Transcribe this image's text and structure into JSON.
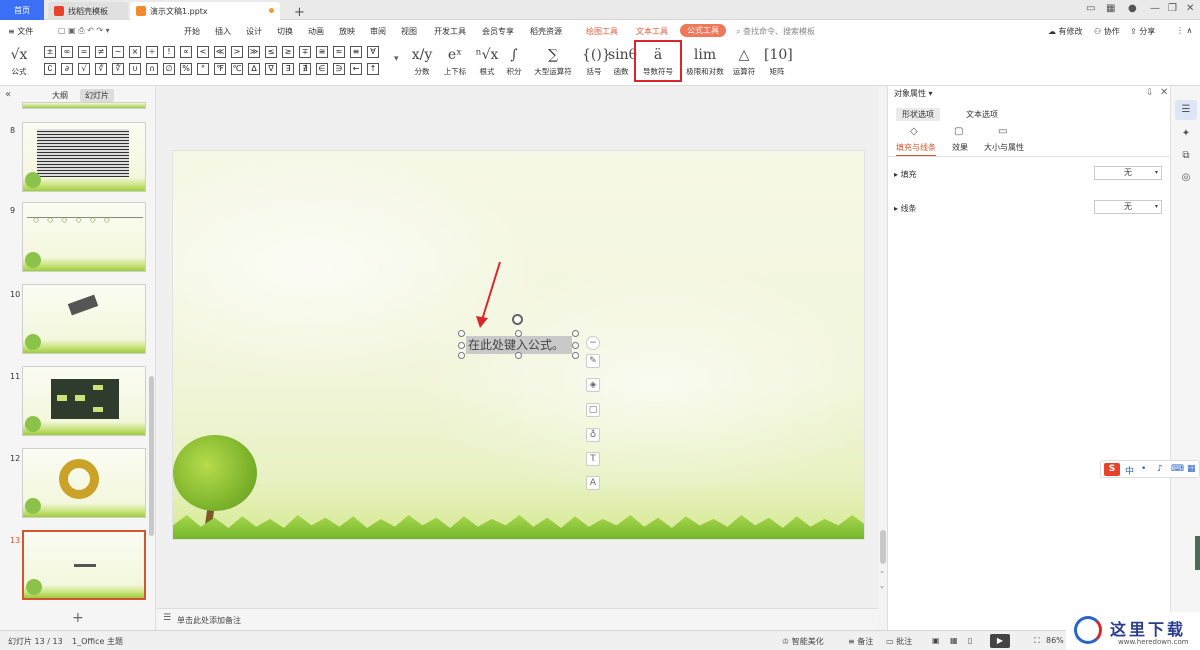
{
  "titlebar": {
    "home_tab": "首页",
    "template_tab": "找稻壳模板",
    "doc_tab": "演示文稿1.pptx",
    "add_tab": "+"
  },
  "menu": {
    "file": "≡ 文件",
    "items": [
      "开始",
      "插入",
      "设计",
      "切换",
      "动画",
      "放映",
      "审阅",
      "视图",
      "开发工具",
      "会员专享",
      "稻壳资源"
    ],
    "ctx_draw": "绘图工具",
    "ctx_text": "文本工具",
    "ctx_formula": "公式工具",
    "search": "查找命令、搜索模板",
    "changes": "有修改",
    "collab": "协作",
    "share": "分享"
  },
  "ribbon": {
    "formula_btn": "公式",
    "symbols_row1": [
      "±",
      "∞",
      "=",
      "≠",
      "~",
      "×",
      "÷",
      "!",
      "∝",
      "<",
      "≪",
      ">",
      "≫",
      "≤",
      "≥",
      "∓",
      "≅",
      "≈",
      "≡",
      "∀"
    ],
    "symbols_row2": [
      "∁",
      "∂",
      "√",
      "∛",
      "∜",
      "∪",
      "∩",
      "∅",
      "%",
      "°",
      "℉",
      "℃",
      "∆",
      "∇",
      "∃",
      "∄",
      "∈",
      "∋",
      "←",
      "↑"
    ],
    "groups": [
      {
        "icon": "x/y",
        "label": "分数"
      },
      {
        "icon": "eˣ",
        "label": "上下标"
      },
      {
        "icon": "ⁿ√x",
        "label": "根式"
      },
      {
        "icon": "∫",
        "label": "积分"
      },
      {
        "icon": "∑",
        "label": "大型运算符"
      },
      {
        "icon": "{()}",
        "label": "括号"
      },
      {
        "icon": "sinθ",
        "label": "函数"
      },
      {
        "icon": "ä",
        "label": "导数符号"
      },
      {
        "icon": "lim",
        "label": "极限和对数"
      },
      {
        "icon": "△",
        "label": "运算符"
      },
      {
        "icon": "[10]",
        "label": "矩阵"
      }
    ]
  },
  "left_panel": {
    "tab_outline": "大纲",
    "tab_slides": "幻灯片",
    "slides": [
      "8",
      "9",
      "10",
      "11",
      "12",
      "13"
    ],
    "active_slide": "13",
    "add": "+"
  },
  "slide": {
    "formula_placeholder": "在此处键入公式。"
  },
  "notes": {
    "text": "单击此处添加备注"
  },
  "right_pane": {
    "title": "对象属性",
    "tab_shape": "形状选项",
    "tab_text": "文本选项",
    "sub_fill": "填充与线条",
    "sub_effect": "效果",
    "sub_size": "大小与属性",
    "fill_label": "填充",
    "fill_value": "无",
    "line_label": "线条",
    "line_value": "无"
  },
  "status": {
    "slide_info": "幻灯片 13 / 13",
    "theme": "1_Office 主题",
    "smart": "智能美化",
    "notes": "备注",
    "comments": "批注",
    "zoom": "86%"
  },
  "ime": {
    "logo": "S",
    "mode": "中"
  },
  "watermark": {
    "title": "这里下载",
    "url": "www.heredown.com"
  },
  "colors": {
    "accent": "#3b6ff5",
    "formula_tab": "#f0785a",
    "highlight": "#d9262b",
    "active_slide": "#d2572f"
  }
}
